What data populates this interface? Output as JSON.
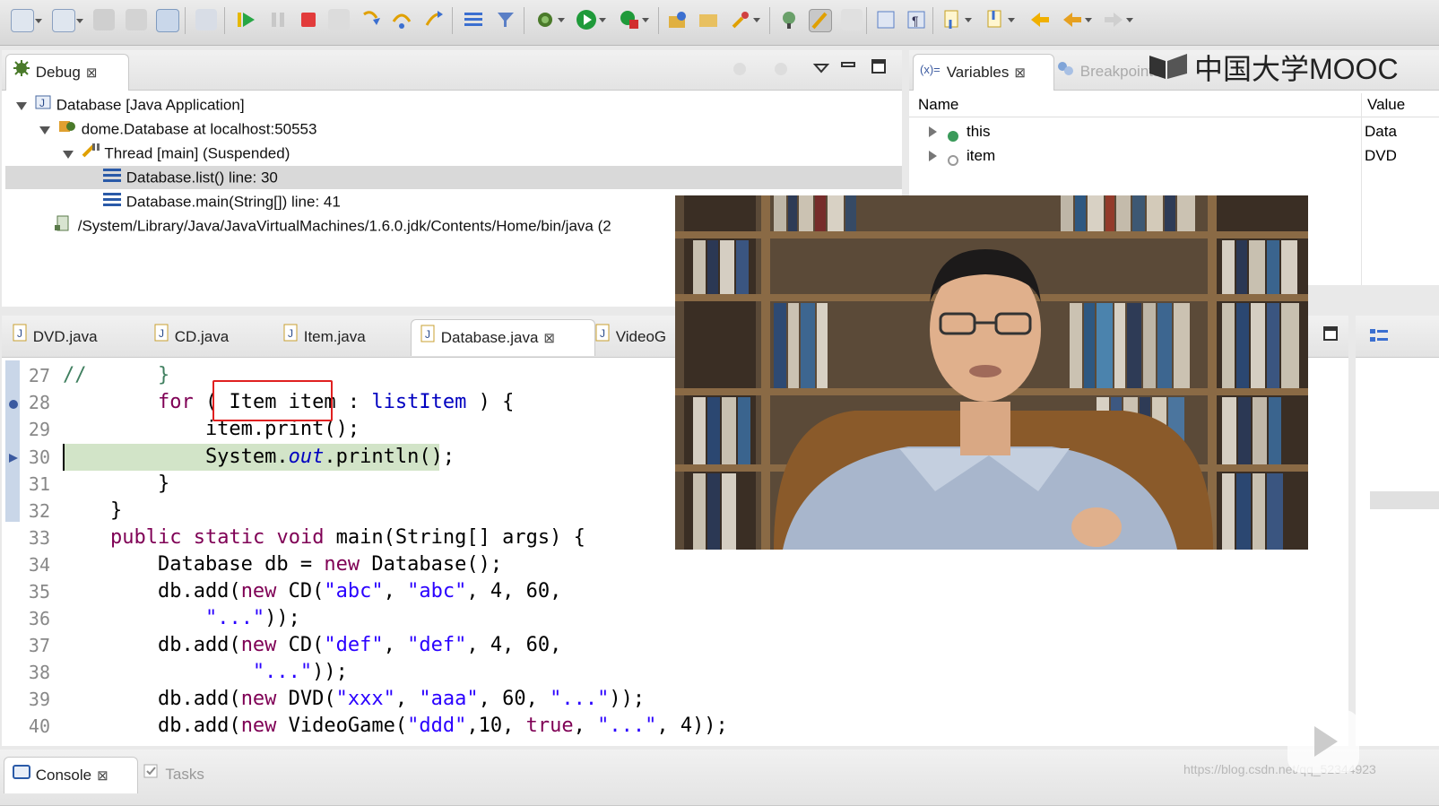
{
  "watermark": {
    "brand": "中国大学MOOC",
    "url": "https://blog.csdn.net/qq_52344923"
  },
  "debug_panel": {
    "tab_label": "Debug",
    "tree": [
      {
        "label": "Database [Java Application]"
      },
      {
        "label": "dome.Database at localhost:50553"
      },
      {
        "label": "Thread [main] (Suspended)"
      },
      {
        "label": "Database.list() line: 30"
      },
      {
        "label": "Database.main(String[]) line: 41"
      },
      {
        "label": "/System/Library/Java/JavaVirtualMachines/1.6.0.jdk/Contents/Home/bin/java (2"
      }
    ]
  },
  "variables_panel": {
    "tab_label": "Variables",
    "tab2_label": "Breakpoints",
    "col_name": "Name",
    "col_value": "Value",
    "rows": [
      {
        "name": "this",
        "value": "Data"
      },
      {
        "name": "item",
        "value": "DVD"
      }
    ]
  },
  "editor": {
    "tabs": [
      "DVD.java",
      "CD.java",
      "Item.java",
      "Database.java",
      "VideoG"
    ],
    "active_tab": "Database.java",
    "lines": [
      {
        "n": "27",
        "text": "//      }"
      },
      {
        "n": "28",
        "text": "        for ( Item item : listItem ) {"
      },
      {
        "n": "29",
        "text": "            item.print();"
      },
      {
        "n": "30",
        "text": "            System.out.println();"
      },
      {
        "n": "31",
        "text": "        }"
      },
      {
        "n": "32",
        "text": "    }"
      },
      {
        "n": "33",
        "text": "    public static void main(String[] args) {"
      },
      {
        "n": "34",
        "text": "        Database db = new Database();"
      },
      {
        "n": "35",
        "text": "        db.add(new CD(\"abc\", \"abc\", 4, 60,"
      },
      {
        "n": "36",
        "text": "            \"...\"));"
      },
      {
        "n": "37",
        "text": "        db.add(new CD(\"def\", \"def\", 4, 60,"
      },
      {
        "n": "38",
        "text": "                \"...\"));"
      },
      {
        "n": "39",
        "text": "        db.add(new DVD(\"xxx\", \"aaa\", 60, \"...\"));"
      },
      {
        "n": "40",
        "text": "        db.add(new VideoGame(\"ddd\",10, true, \"...\", 4));"
      }
    ]
  },
  "bottom_panel": {
    "tabs": [
      "Console",
      "Tasks"
    ]
  },
  "colors": {
    "current_line": "#d2e4c8",
    "keyword": "#7f0055",
    "string": "#2a00ff",
    "highlight_box": "#e02020"
  }
}
